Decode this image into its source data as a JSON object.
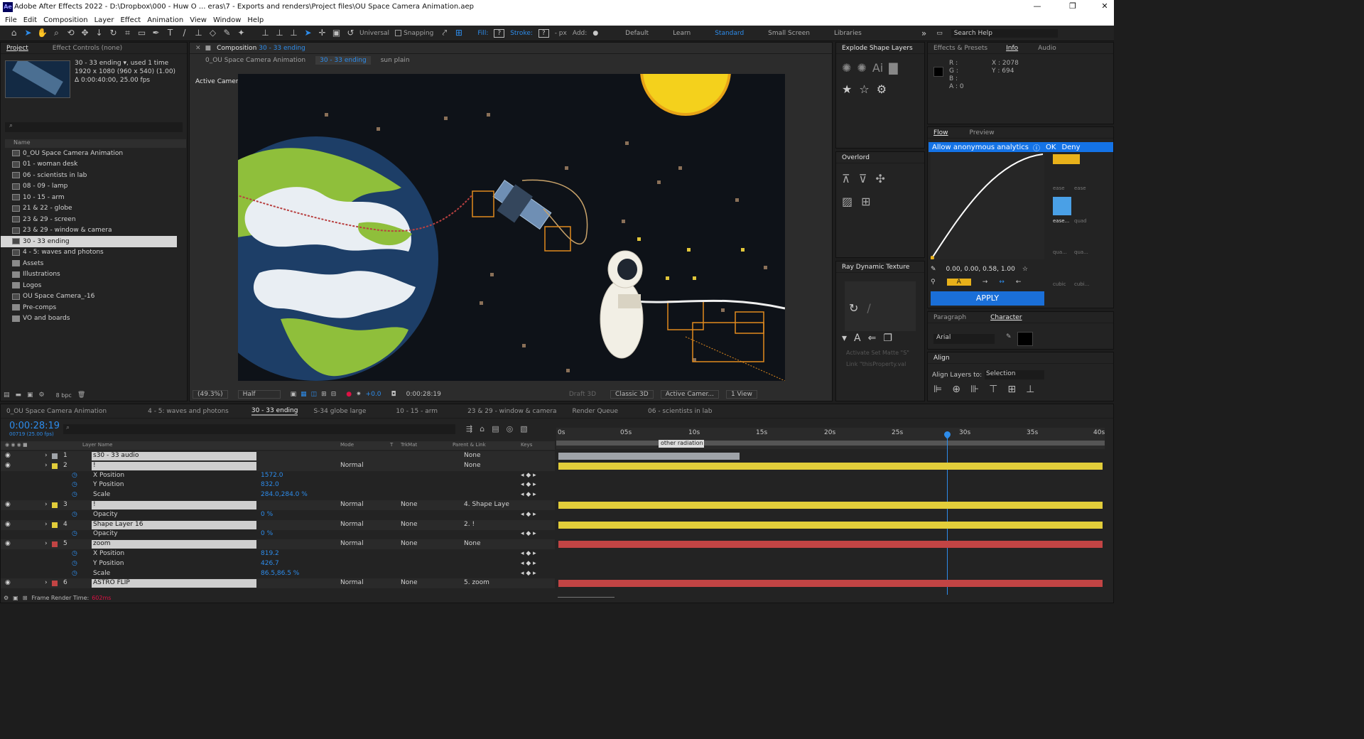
{
  "app": {
    "logo": "Ae",
    "title": "Adobe After Effects 2022 - D:\\Dropbox\\000 - Huw O ... eras\\7 - Exports and renders\\Project files\\OU Space Camera  Animation.aep",
    "win_min": "—",
    "win_max": "❐",
    "win_close": "✕"
  },
  "menu": [
    "File",
    "Edit",
    "Composition",
    "Layer",
    "Effect",
    "Animation",
    "View",
    "Window",
    "Help"
  ],
  "toolbar": {
    "universal": "Universal",
    "snapping": "Snapping",
    "fill": "Fill:",
    "stroke": "Stroke:",
    "px": "- px",
    "add": "Add:",
    "fill_val": "?",
    "stroke_val": "?",
    "workspaces": [
      "Default",
      "Learn",
      "Standard",
      "Small Screen",
      "Libraries"
    ],
    "more": "»",
    "search": "Search Help"
  },
  "project": {
    "tab": "Project",
    "effect_controls": "Effect Controls  (none)",
    "comp_name": "30 - 33 ending ▾, used 1 time",
    "comp_size": "1920 x 1080  (960 x 540) (1.00)",
    "comp_dur": "Δ 0:00:40:00, 25.00 fps",
    "col_name": "Name",
    "search_icon": "⌕",
    "items": [
      {
        "label": "0_OU Space Camera Animation",
        "type": "comp"
      },
      {
        "label": "01 - woman desk",
        "type": "comp"
      },
      {
        "label": "06 - scientists in lab",
        "type": "comp"
      },
      {
        "label": "08 - 09 - lamp",
        "type": "comp"
      },
      {
        "label": "10 - 15 - arm",
        "type": "comp"
      },
      {
        "label": "21 & 22 - globe",
        "type": "comp"
      },
      {
        "label": "23 & 29 - screen",
        "type": "comp"
      },
      {
        "label": "23 & 29 - window & camera",
        "type": "comp"
      },
      {
        "label": "30 - 33 ending",
        "type": "comp",
        "selected": true
      },
      {
        "label": "4 - 5: waves and photons",
        "type": "comp"
      },
      {
        "label": "Assets",
        "type": "folder"
      },
      {
        "label": "Illustrations",
        "type": "folder"
      },
      {
        "label": "Logos",
        "type": "folder"
      },
      {
        "label": "OU Space Camera_-16",
        "type": "comp"
      },
      {
        "label": "Pre-comps",
        "type": "folder"
      },
      {
        "label": "VO and boards",
        "type": "folder"
      }
    ],
    "bpc": "8 bpc"
  },
  "comp": {
    "tab_prefix": "Composition",
    "tab_name": "30 - 33 ending",
    "crumbs": [
      "0_OU Space Camera Animation",
      "30 - 33 ending",
      "sun plain"
    ],
    "camera": "Active Camera (Default)",
    "zoom": "(49.3%)",
    "res": "Half",
    "exposure": "+0.0",
    "time": "0:00:28:19",
    "draft": "Draft 3D",
    "renderer": "Classic 3D",
    "view": "Active Camer...",
    "views": "1 View"
  },
  "right": {
    "explode": "Explode Shape Layers",
    "overlord": "Overlord",
    "ray": "Ray Dynamic Texture",
    "ray_opt1": "Activate Set Matte \"S\"",
    "ray_opt2": "Link   \"thisProperty.val",
    "effects": "Effects & Presets",
    "info": "Info",
    "audio": "Audio",
    "info_vals": [
      "R :",
      "G :",
      "B :",
      "A : 0"
    ],
    "xy": [
      "X : 2078",
      "Y : 694"
    ],
    "flow": "Flow",
    "preview": "Preview",
    "analytics": "Allow anonymous analytics",
    "ok": "OK",
    "deny": "Deny",
    "curve": "0.00, 0.00, 0.58, 1.00",
    "apply": "APPLY",
    "presets": [
      "ease",
      "ease...",
      "ease...",
      "quad",
      "qua...",
      "qua...",
      "cubic",
      "cubi..."
    ],
    "paragraph": "Paragraph",
    "character": "Character",
    "font": "Arial",
    "align": "Align",
    "align_to": "Align Layers to:",
    "align_sel": "Selection"
  },
  "timeline": {
    "tabs": [
      "0_OU Space Camera Animation",
      "4 - 5: waves and photons",
      "30 - 33 ending",
      "S-34 globe large",
      "10 - 15 - arm",
      "23 & 29 - window & camera",
      "Render Queue",
      "06 - scientists in lab"
    ],
    "active_tab": "30 - 33 ending",
    "timecode": "0:00:28:19",
    "frames": "00719 (25.00 fps)",
    "cols": {
      "name": "Layer Name",
      "mode": "Mode",
      "t": "T",
      "trkmat": "TrkMat",
      "parent": "Parent & Link",
      "keys": "Keys"
    },
    "ruler": [
      "0s",
      "05s",
      "10s",
      "15s",
      "20s",
      "25s",
      "30s",
      "35s",
      "40s"
    ],
    "marker": "other radiation",
    "footer": "Frame Render Time:",
    "render_time": "602ms",
    "rows": [
      {
        "num": "1",
        "name": "s30 - 33 audio",
        "kind": "layer",
        "parent": "None",
        "color": "#9fa3a8"
      },
      {
        "num": "2",
        "name": "!",
        "kind": "layer",
        "mode": "Normal",
        "parent": "None",
        "color": "#e2cd3a"
      },
      {
        "name": "X Position",
        "kind": "prop",
        "val": "1572.0"
      },
      {
        "name": "Y Position",
        "kind": "prop",
        "val": "832.0"
      },
      {
        "name": "Scale",
        "kind": "prop",
        "val": "284.0,284.0 %"
      },
      {
        "num": "3",
        "name": "!",
        "kind": "layer",
        "mode": "Normal",
        "trk": "None",
        "parent": "4. Shape Laye",
        "color": "#e2cd3a"
      },
      {
        "name": "Opacity",
        "kind": "prop",
        "val": "0 %"
      },
      {
        "num": "4",
        "name": "Shape Layer 16",
        "kind": "layer",
        "mode": "Normal",
        "trk": "None",
        "parent": "2. !",
        "color": "#e2cd3a"
      },
      {
        "name": "Opacity",
        "kind": "prop",
        "val": "0 %"
      },
      {
        "num": "5",
        "name": "zoom",
        "kind": "layer",
        "mode": "Normal",
        "trk": "None",
        "parent": "None",
        "color": "#c24444"
      },
      {
        "name": "X Position",
        "kind": "prop",
        "val": "819.2"
      },
      {
        "name": "Y Position",
        "kind": "prop",
        "val": "426.7"
      },
      {
        "name": "Scale",
        "kind": "prop",
        "val": "86.5,86.5 %"
      },
      {
        "num": "6",
        "name": "ASTRO FLIP",
        "kind": "layer",
        "mode": "Normal",
        "trk": "None",
        "parent": "5. zoom",
        "color": "#c24444"
      }
    ]
  }
}
